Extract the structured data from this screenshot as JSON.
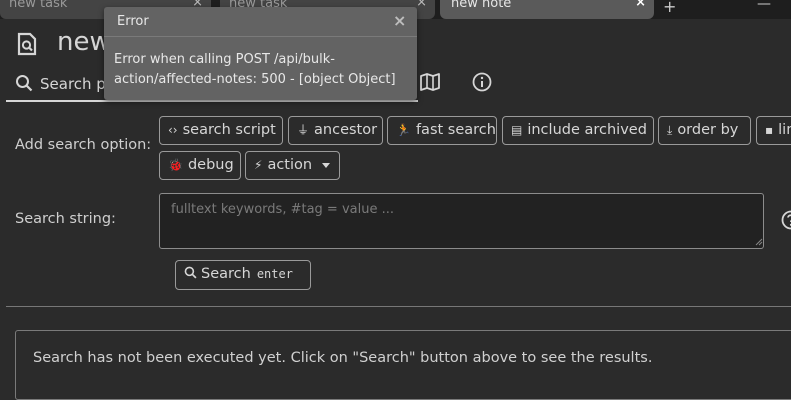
{
  "tabs": [
    {
      "label": "new task",
      "active": false
    },
    {
      "label": "new task",
      "active": false
    },
    {
      "label": "new note",
      "active": true
    }
  ],
  "tab_close_glyph": "×",
  "new_tab_glyph": "+",
  "minimize_glyph": "—",
  "note": {
    "title": "new note",
    "icon": "note-search-icon"
  },
  "ribbon": {
    "active_label": "Search parameters",
    "icons": [
      "search-icon",
      "note-map-icon",
      "info-icon"
    ]
  },
  "search_options": {
    "label": "Add search option:",
    "buttons": [
      {
        "icon": "‹›",
        "label": "search script",
        "icon_name": "code-icon"
      },
      {
        "icon": "⏚",
        "label": "ancestor",
        "icon_name": "filter-icon"
      },
      {
        "icon": "🏃",
        "label": "fast search",
        "icon_name": "run-icon"
      },
      {
        "icon": "▤",
        "label": "include archived",
        "icon_name": "archive-icon"
      },
      {
        "icon": "⤓",
        "label": "order by",
        "icon_name": "sort-icon"
      },
      {
        "icon": "▪",
        "label": "limit",
        "icon_name": "limit-icon"
      },
      {
        "icon": "🐞",
        "label": "debug",
        "icon_name": "bug-icon"
      },
      {
        "icon": "⚡",
        "label": "action",
        "icon_name": "lightning-icon"
      }
    ]
  },
  "search_string": {
    "label": "Search string:",
    "placeholder": "fulltext keywords, #tag = value ..."
  },
  "search_button": {
    "label": "Search",
    "shortcut": "enter"
  },
  "results": {
    "message": "Search has not been executed yet. Click on \"Search\" button above to see the results."
  },
  "toast": {
    "title": "Error",
    "close_glyph": "×",
    "message": "Error when calling POST /api/bulk-action/affected-notes: 500 - [object Object]"
  },
  "colors": {
    "background": "#2b2b2b",
    "toast": "#636363",
    "tab_active": "#5a5a5a"
  }
}
